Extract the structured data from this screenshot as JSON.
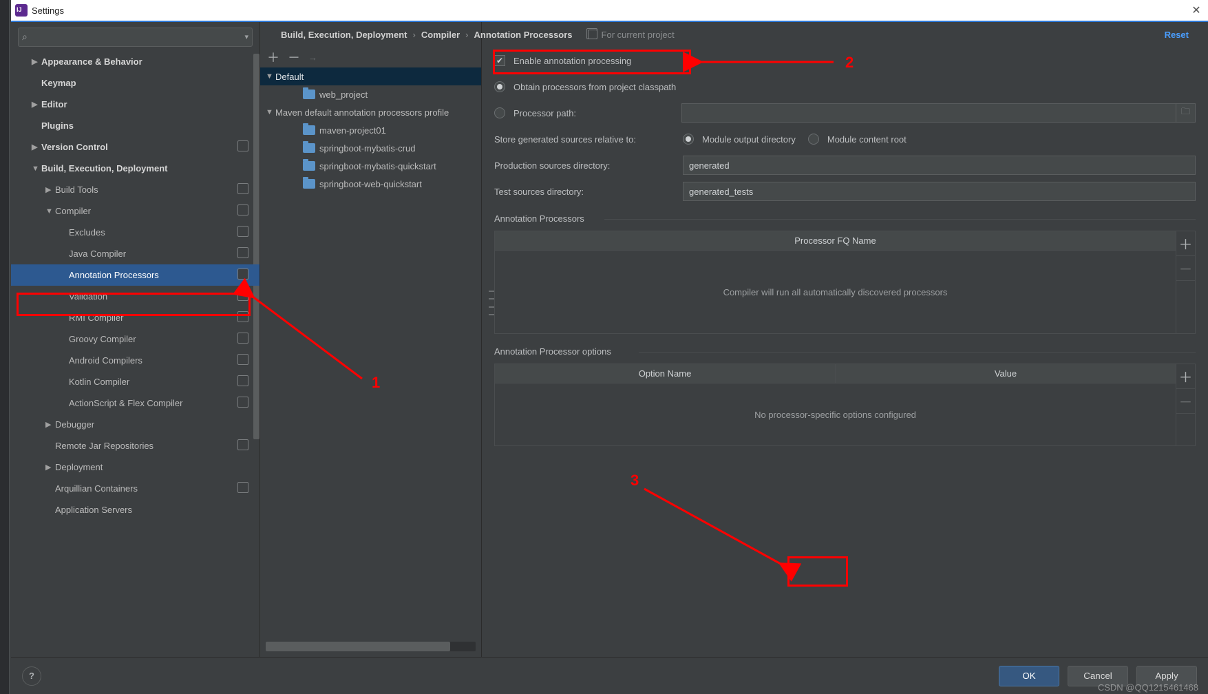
{
  "window": {
    "title": "Settings"
  },
  "search": {
    "placeholder": ""
  },
  "nav": {
    "items": [
      {
        "label": "Appearance & Behavior",
        "arrow": "right",
        "bold": true,
        "pad": 1,
        "copy": false
      },
      {
        "label": "Keymap",
        "arrow": "none",
        "bold": true,
        "pad": 1,
        "copy": false
      },
      {
        "label": "Editor",
        "arrow": "right",
        "bold": true,
        "pad": 1,
        "copy": false
      },
      {
        "label": "Plugins",
        "arrow": "none",
        "bold": true,
        "pad": 1,
        "copy": false
      },
      {
        "label": "Version Control",
        "arrow": "right",
        "bold": true,
        "pad": 1,
        "copy": true
      },
      {
        "label": "Build, Execution, Deployment",
        "arrow": "down",
        "bold": true,
        "pad": 1,
        "copy": false
      },
      {
        "label": "Build Tools",
        "arrow": "right",
        "bold": false,
        "pad": 2,
        "copy": true
      },
      {
        "label": "Compiler",
        "arrow": "down",
        "bold": false,
        "pad": 2,
        "copy": true
      },
      {
        "label": "Excludes",
        "arrow": "none",
        "bold": false,
        "pad": 3,
        "copy": true
      },
      {
        "label": "Java Compiler",
        "arrow": "none",
        "bold": false,
        "pad": 3,
        "copy": true
      },
      {
        "label": "Annotation Processors",
        "arrow": "none",
        "bold": false,
        "pad": 3,
        "copy": true,
        "selected": true
      },
      {
        "label": "Validation",
        "arrow": "none",
        "bold": false,
        "pad": 3,
        "copy": true
      },
      {
        "label": "RMI Compiler",
        "arrow": "none",
        "bold": false,
        "pad": 3,
        "copy": true
      },
      {
        "label": "Groovy Compiler",
        "arrow": "none",
        "bold": false,
        "pad": 3,
        "copy": true
      },
      {
        "label": "Android Compilers",
        "arrow": "none",
        "bold": false,
        "pad": 3,
        "copy": true
      },
      {
        "label": "Kotlin Compiler",
        "arrow": "none",
        "bold": false,
        "pad": 3,
        "copy": true
      },
      {
        "label": "ActionScript & Flex Compiler",
        "arrow": "none",
        "bold": false,
        "pad": 3,
        "copy": true
      },
      {
        "label": "Debugger",
        "arrow": "right",
        "bold": false,
        "pad": 2,
        "copy": false
      },
      {
        "label": "Remote Jar Repositories",
        "arrow": "none",
        "bold": false,
        "pad": 2,
        "copy": true
      },
      {
        "label": "Deployment",
        "arrow": "right",
        "bold": false,
        "pad": 2,
        "copy": false
      },
      {
        "label": "Arquillian Containers",
        "arrow": "none",
        "bold": false,
        "pad": 2,
        "copy": true
      },
      {
        "label": "Application Servers",
        "arrow": "none",
        "bold": false,
        "pad": 2,
        "copy": false
      }
    ]
  },
  "breadcrumb": {
    "parts": [
      "Build, Execution, Deployment",
      "Compiler",
      "Annotation Processors"
    ],
    "scope": "For current project",
    "reset": "Reset"
  },
  "tree": {
    "rows": [
      {
        "label": "Default",
        "arrow": "down",
        "pad": 0,
        "selected": true,
        "folder": false
      },
      {
        "label": "web_project",
        "arrow": "none",
        "pad": 2,
        "folder": true
      },
      {
        "label": "Maven default annotation processors profile",
        "arrow": "down",
        "pad": 0,
        "folder": false
      },
      {
        "label": "maven-project01",
        "arrow": "none",
        "pad": 2,
        "folder": true
      },
      {
        "label": "springboot-mybatis-crud",
        "arrow": "none",
        "pad": 2,
        "folder": true
      },
      {
        "label": "springboot-mybatis-quickstart",
        "arrow": "none",
        "pad": 2,
        "folder": true
      },
      {
        "label": "springboot-web-quickstart",
        "arrow": "none",
        "pad": 2,
        "folder": true
      }
    ]
  },
  "form": {
    "enable": "Enable annotation processing",
    "obtain": "Obtain processors from project classpath",
    "procPath": "Processor path:",
    "procPathValue": "",
    "storeLabel": "Store generated sources relative to:",
    "storeOpt1": "Module output directory",
    "storeOpt2": "Module content root",
    "prodDirLabel": "Production sources directory:",
    "prodDirValue": "generated",
    "testDirLabel": "Test sources directory:",
    "testDirValue": "generated_tests",
    "procSection": "Annotation Processors",
    "procTh": "Processor FQ Name",
    "procEmpty": "Compiler will run all automatically discovered processors",
    "optSection": "Annotation Processor options",
    "optTh1": "Option Name",
    "optTh2": "Value",
    "optEmpty": "No processor-specific options configured"
  },
  "footer": {
    "ok": "OK",
    "cancel": "Cancel",
    "apply": "Apply"
  },
  "annotations": {
    "n1": "1",
    "n2": "2",
    "n3": "3"
  },
  "watermark": "CSDN @QQ1215461468"
}
